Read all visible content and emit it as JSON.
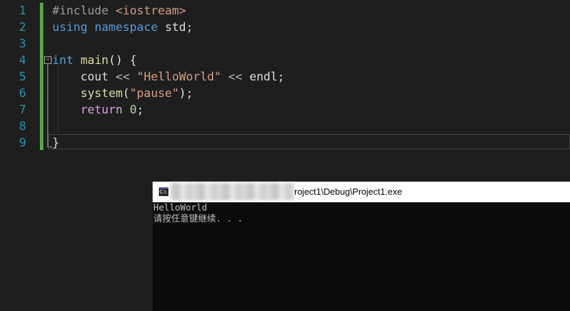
{
  "editor": {
    "line_numbers": [
      "1",
      "2",
      "3",
      "4",
      "5",
      "6",
      "7",
      "8",
      "9"
    ],
    "lines": {
      "l1": {
        "directive": "#include",
        "header": "<iostream>"
      },
      "l2": {
        "kw_using": "using",
        "kw_namespace": "namespace",
        "rest": "std;"
      },
      "l4": {
        "kw_int": "int",
        "fn_main": "main",
        "rest": "() {"
      },
      "l5": {
        "cout": "cout",
        "op1": "<<",
        "str": "\"HelloWorld\"",
        "op2": "<<",
        "endl": "endl;"
      },
      "l6": {
        "fn_system": "system",
        "open": "(",
        "str": "\"pause\"",
        "close": ");"
      },
      "l7": {
        "kw_return": "return",
        "num": "0",
        "end": ";"
      },
      "l9": {
        "brace": "}"
      }
    },
    "fold_glyph": "−"
  },
  "console": {
    "icon_text": "C:\\",
    "title": "roject1\\Debug\\Project1.exe",
    "output": [
      "HelloWorld",
      "请按任意键继续. . ."
    ]
  }
}
